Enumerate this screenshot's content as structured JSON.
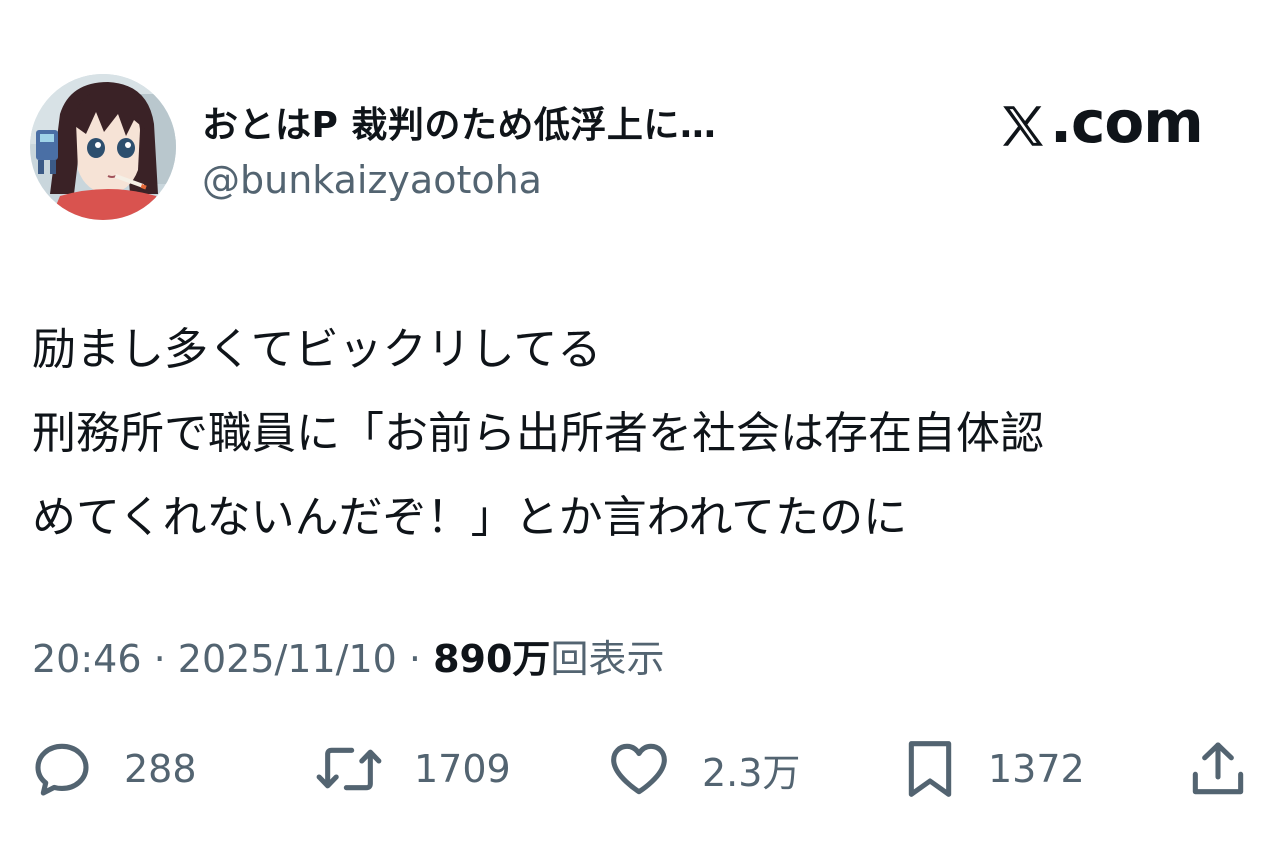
{
  "author": {
    "display_name": "おとはP 裁判のため低浮上に…",
    "handle": "@bunkaizyaotoha",
    "avatar": "anime-girl-avatar"
  },
  "brand": {
    "label": ".com",
    "logo_icon": "x-logo-icon"
  },
  "tweet": {
    "lines": [
      "励まし多くてビックリしてる",
      "刑務所で職員に「お前ら出所者を社会は存在自体認",
      "めてくれないんだぞ！」とか言われてたのに"
    ]
  },
  "meta": {
    "time": "20:46",
    "separator": "·",
    "date": "2025/11/10",
    "views_count": "890万",
    "views_label": "回表示"
  },
  "actions": {
    "reply_count": "288",
    "retweet_count": "1709",
    "like_count": "2.3万",
    "bookmark_count": "1372"
  },
  "colors": {
    "text": "#0f1419",
    "secondary": "#536471",
    "background": "#ffffff"
  }
}
